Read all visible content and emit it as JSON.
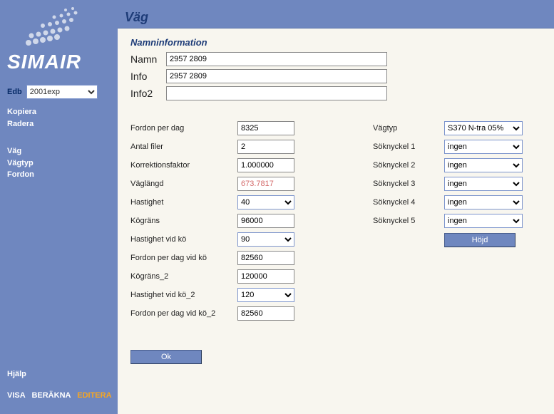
{
  "app": {
    "title": "SIMAIR"
  },
  "sidebar": {
    "edb_label": "Edb",
    "edb_value": "2001exp",
    "links1": {
      "kopiera": "Kopiera",
      "radera": "Radera"
    },
    "links2": {
      "vag": "Väg",
      "vagtyp": "Vägtyp",
      "fordon": "Fordon"
    },
    "help": "Hjälp",
    "visa": "VISA",
    "berakna": "BERÄKNA",
    "editera": "EDITERA"
  },
  "page": {
    "breadcrumb": "Väg",
    "section_title": "Namninformation",
    "labels": {
      "namn": "Namn",
      "info": "Info",
      "info2": "Info2"
    },
    "namn": "2957 2809",
    "info": "2957 2809",
    "info2": ""
  },
  "left": {
    "fordon_per_dag": {
      "label": "Fordon per dag",
      "value": "8325"
    },
    "antal_filer": {
      "label": "Antal filer",
      "value": "2"
    },
    "korrektionsfaktor": {
      "label": "Korrektionsfaktor",
      "value": "1.000000"
    },
    "vaglangd": {
      "label": "Väglängd",
      "value": "673.7817"
    },
    "hastighet": {
      "label": "Hastighet",
      "value": "40"
    },
    "kograns": {
      "label": "Kögräns",
      "value": "96000"
    },
    "hastighet_vid_ko": {
      "label": "Hastighet vid kö",
      "value": "90"
    },
    "fordon_per_dag_vid_ko": {
      "label": "Fordon per dag vid kö",
      "value": "82560"
    },
    "kograns_2": {
      "label": "Kögräns_2",
      "value": "120000"
    },
    "hastighet_vid_ko_2": {
      "label": "Hastighet vid kö_2",
      "value": "120"
    },
    "fordon_per_dag_vid_ko_2": {
      "label": "Fordon per dag vid kö_2",
      "value": "82560"
    }
  },
  "right": {
    "vagtyp": {
      "label": "Vägtyp",
      "value": "S370 N-tra 05%"
    },
    "soknyckel1": {
      "label": "Söknyckel 1",
      "value": "ingen"
    },
    "soknyckel2": {
      "label": "Söknyckel 2",
      "value": "ingen"
    },
    "soknyckel3": {
      "label": "Söknyckel 3",
      "value": "ingen"
    },
    "soknyckel4": {
      "label": "Söknyckel 4",
      "value": "ingen"
    },
    "soknyckel5": {
      "label": "Söknyckel 5",
      "value": "ingen"
    },
    "hojd_button": "Höjd"
  },
  "buttons": {
    "ok": "Ok"
  }
}
